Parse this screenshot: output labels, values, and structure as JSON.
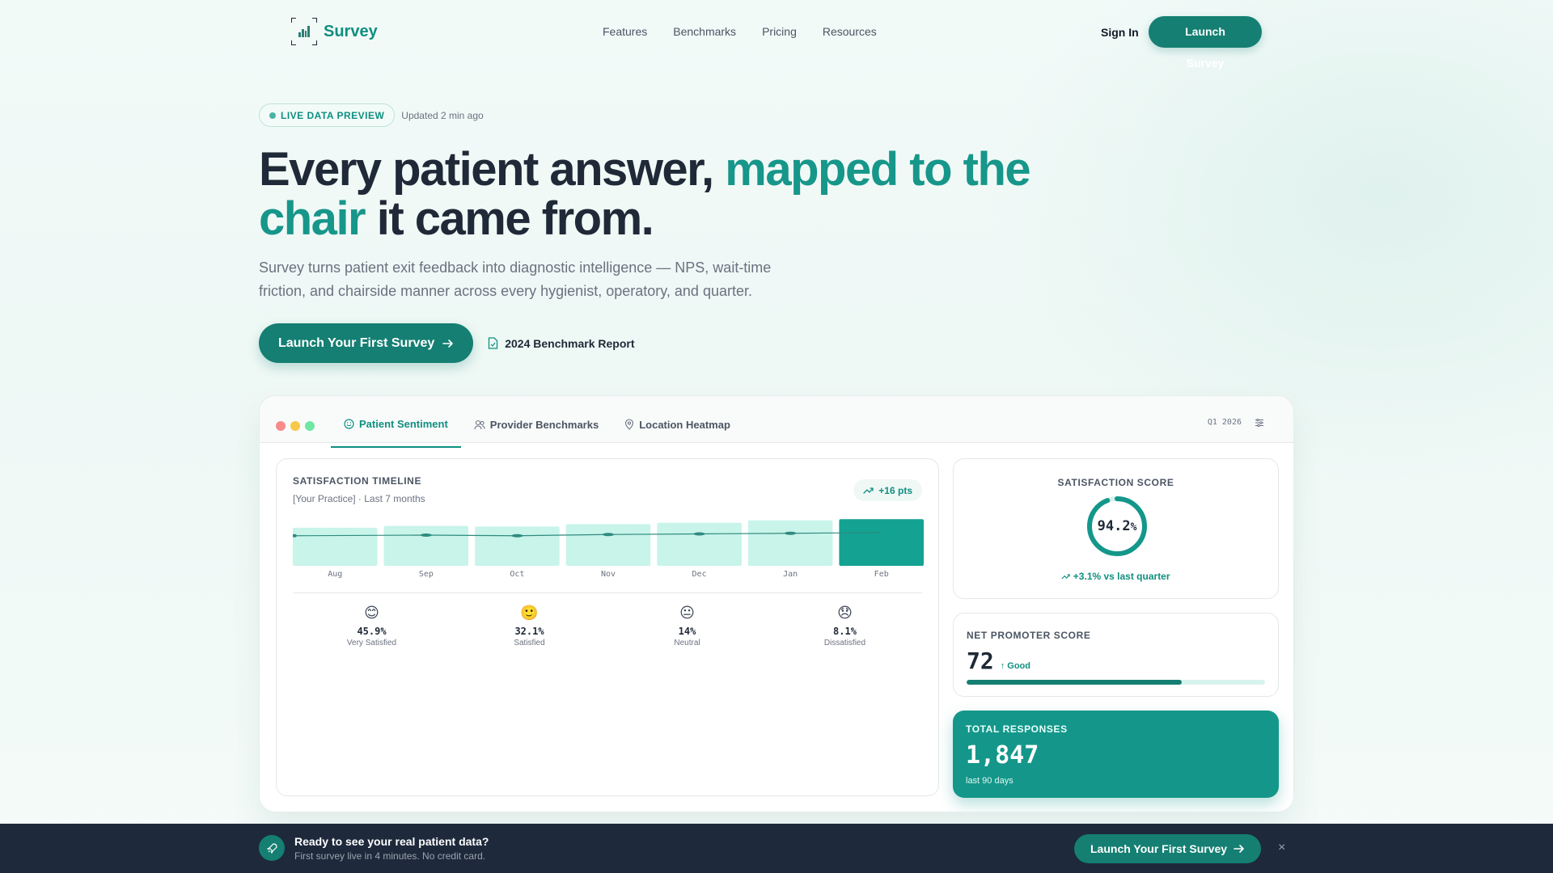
{
  "brand": {
    "name": "Survey",
    "accent": "#0f8f80"
  },
  "nav": {
    "links": [
      "Features",
      "Benchmarks",
      "Pricing",
      "Resources"
    ],
    "sign_in": "Sign In",
    "launch": "Launch Survey"
  },
  "hero": {
    "badge": "LIVE DATA PREVIEW",
    "updated": "Updated 2 min ago",
    "headline_part1": "Every patient answer, ",
    "headline_accent": "mapped to the chair",
    "headline_part2": " it came from.",
    "subtitle": "Survey turns patient exit feedback into diagnostic intelligence — NPS, wait-time friction, and chairside manner across every hygienist, operatory, and quarter.",
    "cta_primary": "Launch Your First Survey",
    "cta_secondary": "2024 Benchmark Report"
  },
  "dashboard": {
    "tabs": [
      {
        "label": "Patient Sentiment",
        "icon": "smile-icon"
      },
      {
        "label": "Provider Benchmarks",
        "icon": "users-icon"
      },
      {
        "label": "Location Heatmap",
        "icon": "pin-icon"
      }
    ],
    "period": "Q1 2026",
    "timeline": {
      "title": "SATISFACTION TIMELINE",
      "subtitle": "[Your Practice] · Last 7 months",
      "trend": "+16 pts"
    },
    "sentiment": [
      {
        "icon": "😊",
        "pct": "45.9%",
        "label": "Very Satisfied"
      },
      {
        "icon": "🙂",
        "pct": "32.1%",
        "label": "Satisfied"
      },
      {
        "icon": "😐",
        "pct": "14%",
        "label": "Neutral"
      },
      {
        "icon": "😞",
        "pct": "8.1%",
        "label": "Dissatisfied"
      }
    ],
    "score": {
      "title": "SATISFACTION SCORE",
      "value": "94.2",
      "unit": "%",
      "pct": 0.942,
      "delta": "+3.1% vs last quarter"
    },
    "nps": {
      "title": "NET PROMOTER SCORE",
      "value": "72",
      "tag": "↑ Good",
      "fill": 0.72
    },
    "total": {
      "title": "TOTAL RESPONSES",
      "value": "1,847",
      "sub": "last 90 days"
    }
  },
  "chart_data": {
    "type": "bar",
    "categories": [
      "Aug",
      "Sep",
      "Oct",
      "Nov",
      "Dec",
      "Jan",
      "Feb"
    ],
    "values": [
      62,
      65,
      64,
      68,
      70,
      74,
      76
    ],
    "line": [
      49,
      50,
      49,
      51,
      52,
      53,
      54
    ],
    "highlight_index": 6,
    "colors": {
      "bar": "#c8f4ea",
      "highlight": "#14a292",
      "line": "#2f8a7f"
    }
  },
  "banner": {
    "title": "Ready to see your real patient data?",
    "subtitle": "First survey live in 4 minutes. No credit card.",
    "cta": "Launch Your First Survey",
    "close": "×"
  }
}
